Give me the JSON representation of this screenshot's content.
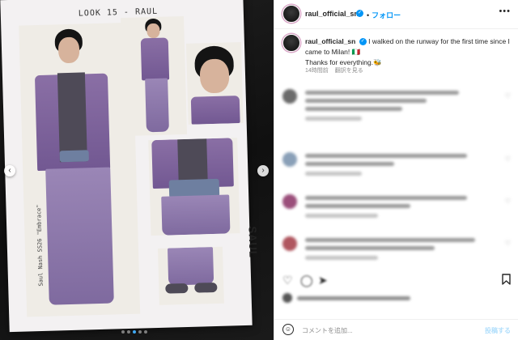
{
  "media": {
    "sheet_title": "LOOK 15 - RAUL",
    "sheet_side_note": "Saul Nash SS26 \"Embrace\"",
    "sheet_brand": "SAUL",
    "prev_icon": "chevron-left-icon",
    "next_icon": "chevron-right-icon",
    "carousel_count": 5,
    "carousel_active": 3
  },
  "header": {
    "username": "raul_official_sn",
    "verified_icon": "verified-badge-icon",
    "separator": "•",
    "follow_label": "フォロー",
    "more_icon": "more-horizontal-icon"
  },
  "caption": {
    "username": "raul_official_sn",
    "text_line1": "I walked on the runway for the first time since I came to Milan! 🇮🇹",
    "text_line2": "Thanks for everything.🐝",
    "time": "14時間前",
    "translate_label": "翻訳を見る"
  },
  "actions": {
    "bookmark_icon": "bookmark-icon"
  },
  "add_comment": {
    "emoji_icon": "emoji-icon",
    "placeholder": "コメントを追加...",
    "post_label": "投稿する"
  },
  "colors": {
    "accent": "#0095f6",
    "verified": "#0095f6",
    "post_disabled": "#b2dffc",
    "carousel_active": "#3fa9f5"
  }
}
